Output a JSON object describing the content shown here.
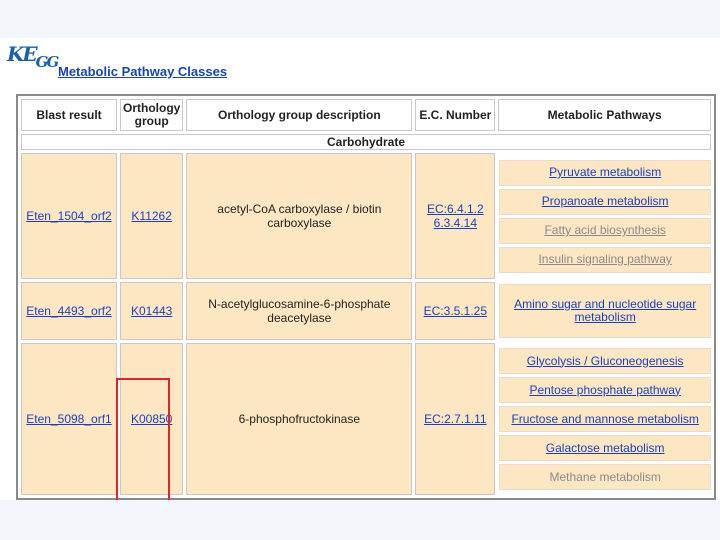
{
  "logo": {
    "main": "KE",
    "small": "GG"
  },
  "page_title": "Metabolic Pathway Classes",
  "headers": [
    "Blast result",
    "Orthology group",
    "Orthology group description",
    "E.C. Number",
    "Metabolic Pathways"
  ],
  "section": "Carbohydrate",
  "rows": [
    {
      "blast": "Eten_1504_orf2",
      "ko": "K11262",
      "description": "acetyl-CoA carboxylase / biotin carboxylase",
      "ec": "EC:6.4.1.2 6.3.4.14",
      "pathways": [
        {
          "label": "Pyruvate metabolism"
        },
        {
          "label": "Propanoate metabolism"
        },
        {
          "label": "Fatty acid biosynthesis"
        },
        {
          "label": "Insulin signaling pathway"
        }
      ]
    },
    {
      "blast": "Eten_4493_orf2",
      "ko": "K01443",
      "description": "N-acetylglucosamine-6-phosphate deacetylase",
      "ec": "EC:3.5.1.25",
      "pathways": [
        {
          "label": "Amino sugar and nucleotide sugar metabolism"
        }
      ]
    },
    {
      "blast": "Eten_5098_orf1",
      "ko": "K00850",
      "description": "6-phosphofructokinase",
      "ec": "EC:2.7.1.11",
      "pathways": [
        {
          "label": "Glycolysis / Gluconeogenesis"
        },
        {
          "label": "Pentose phosphate pathway"
        },
        {
          "label": "Fructose and mannose metabolism"
        },
        {
          "label": "Galactose metabolism"
        },
        {
          "label": "Methane metabolism"
        }
      ]
    }
  ]
}
